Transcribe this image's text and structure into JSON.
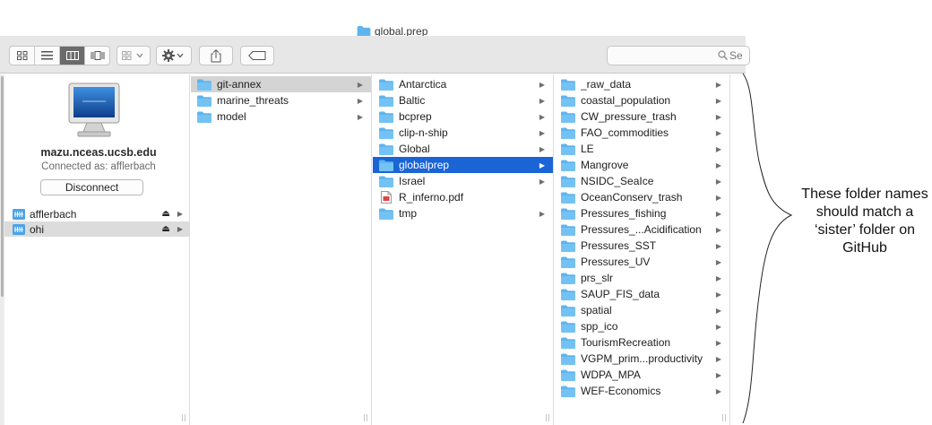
{
  "window": {
    "title": "global.prep"
  },
  "toolbar": {
    "view_icons": [
      "icon-view-icon",
      "list-view-icon",
      "column-view-icon",
      "coverflow-view-icon"
    ],
    "active_view": "column-view-icon",
    "search_placeholder": "Se"
  },
  "sidebar": {
    "server": {
      "host": "mazu.nceas.ucsb.edu",
      "connected_as": "Connected as: afflerbach",
      "disconnect_label": "Disconnect"
    },
    "volumes": [
      {
        "label": "afflerbach",
        "selected": false
      },
      {
        "label": "ohi",
        "selected": true
      }
    ]
  },
  "columns": {
    "col1": [
      {
        "label": "git-annex",
        "type": "folder",
        "has_children": true,
        "selected": "inactive"
      },
      {
        "label": "marine_threats",
        "type": "folder",
        "has_children": true
      },
      {
        "label": "model",
        "type": "folder",
        "has_children": true
      }
    ],
    "col2": [
      {
        "label": "Antarctica",
        "type": "folder",
        "has_children": true
      },
      {
        "label": "Baltic",
        "type": "folder",
        "has_children": true
      },
      {
        "label": "bcprep",
        "type": "folder",
        "has_children": true
      },
      {
        "label": "clip-n-ship",
        "type": "folder",
        "has_children": true
      },
      {
        "label": "Global",
        "type": "folder",
        "has_children": true
      },
      {
        "label": "globalprep",
        "type": "folder",
        "has_children": true,
        "selected": "active"
      },
      {
        "label": "Israel",
        "type": "folder",
        "has_children": true
      },
      {
        "label": "R_inferno.pdf",
        "type": "pdf",
        "has_children": false
      },
      {
        "label": "tmp",
        "type": "folder",
        "has_children": true
      }
    ],
    "col3": [
      {
        "label": "_raw_data",
        "type": "folder",
        "has_children": true
      },
      {
        "label": "coastal_population",
        "type": "folder",
        "has_children": true
      },
      {
        "label": "CW_pressure_trash",
        "type": "folder",
        "has_children": true
      },
      {
        "label": "FAO_commodities",
        "type": "folder",
        "has_children": true
      },
      {
        "label": "LE",
        "type": "folder",
        "has_children": true
      },
      {
        "label": "Mangrove",
        "type": "folder",
        "has_children": true
      },
      {
        "label": "NSIDC_SeaIce",
        "type": "folder",
        "has_children": true
      },
      {
        "label": "OceanConserv_trash",
        "type": "folder",
        "has_children": true
      },
      {
        "label": "Pressures_fishing",
        "type": "folder",
        "has_children": true
      },
      {
        "label": "Pressures_...Acidification",
        "type": "folder",
        "has_children": true
      },
      {
        "label": "Pressures_SST",
        "type": "folder",
        "has_children": true
      },
      {
        "label": "Pressures_UV",
        "type": "folder",
        "has_children": true
      },
      {
        "label": "prs_slr",
        "type": "folder",
        "has_children": true
      },
      {
        "label": "SAUP_FIS_data",
        "type": "folder",
        "has_children": true
      },
      {
        "label": "spatial",
        "type": "folder",
        "has_children": true
      },
      {
        "label": "spp_ico",
        "type": "folder",
        "has_children": true
      },
      {
        "label": "TourismRecreation",
        "type": "folder",
        "has_children": true
      },
      {
        "label": "VGPM_prim...productivity",
        "type": "folder",
        "has_children": true
      },
      {
        "label": "WDPA_MPA",
        "type": "folder",
        "has_children": true
      },
      {
        "label": "WEF-Economics",
        "type": "folder",
        "has_children": true
      }
    ]
  },
  "annotation": {
    "text": "These folder names should match a ‘sister’ folder on GitHub"
  },
  "colors": {
    "selection_active": "#1a64d6",
    "selection_inactive": "#d4d4d4",
    "folder_blue": "#5fb4ee",
    "toolbar_bg": "#e8e7e8"
  }
}
